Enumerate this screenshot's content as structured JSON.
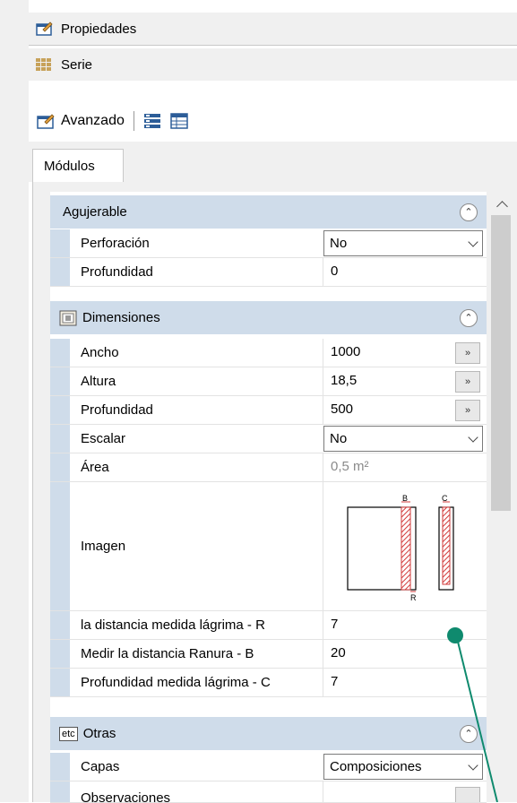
{
  "header": {
    "propiedades_label": "Propiedades",
    "serie_label": "Serie"
  },
  "toolbar": {
    "avanzado_label": "Avanzado"
  },
  "tabs": [
    {
      "label": "Módulos"
    }
  ],
  "categories": {
    "agujerable": {
      "label": "Agujerable"
    },
    "dimensiones": {
      "label": "Dimensiones"
    },
    "otras": {
      "label": "Otras",
      "icon_text": "etc"
    }
  },
  "agujerable_rows": [
    {
      "name": "Perforación",
      "value": "No"
    },
    {
      "name": "Profundidad",
      "value": "0"
    }
  ],
  "dimensiones_rows": [
    {
      "name": "Ancho",
      "value": "1000"
    },
    {
      "name": "Altura",
      "value": "18,5"
    },
    {
      "name": "Profundidad",
      "value": "500"
    },
    {
      "name": "Escalar",
      "value": "No"
    },
    {
      "name": "Área",
      "value": "0,5 m²"
    },
    {
      "name": "Imagen"
    },
    {
      "name": "la distancia medida lágrima - R",
      "value": "7"
    },
    {
      "name": "Medir la distancia Ranura - B",
      "value": "20"
    },
    {
      "name": "Profundidad medida lágrima - C",
      "value": "7"
    }
  ],
  "otras_rows": [
    {
      "name": "Capas",
      "value": "Composiciones"
    },
    {
      "name": "Observaciones"
    }
  ],
  "image_labels": {
    "b": "B",
    "c": "C",
    "r": "R"
  },
  "ellipsis_button": "»",
  "colors": {
    "category_bg": "#cfdcea",
    "annotation": "#0f8a6e",
    "disabled_text": "#8a8a8a"
  }
}
